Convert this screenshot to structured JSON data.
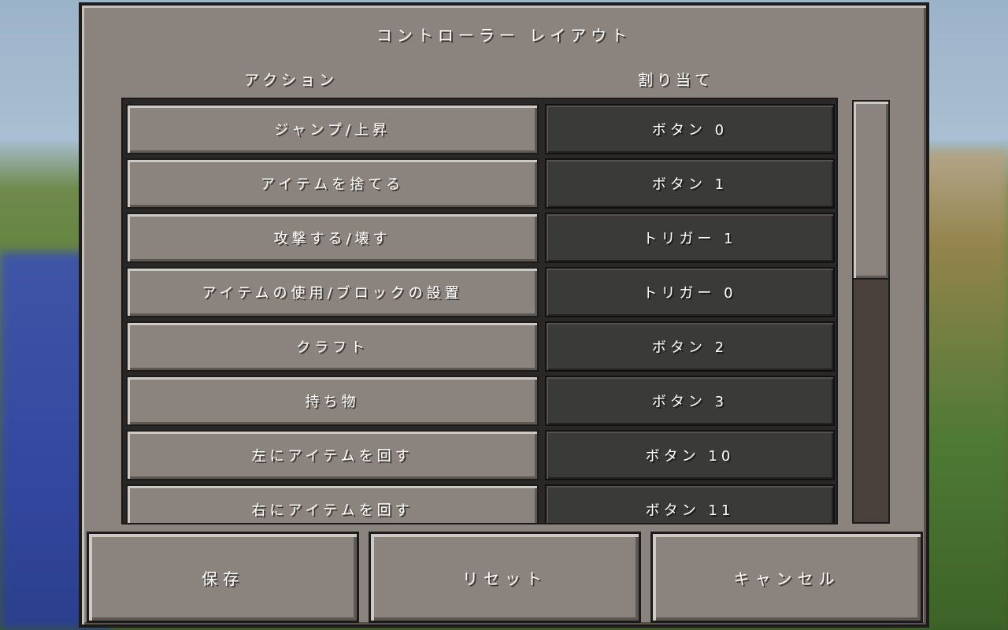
{
  "screen": {
    "title": "コントローラー レイアウト"
  },
  "columns": {
    "action": "アクション",
    "assign": "割り当て"
  },
  "rows": [
    {
      "action": "ジャンプ/上昇",
      "binding": "ボタン 0"
    },
    {
      "action": "アイテムを捨てる",
      "binding": "ボタン 1"
    },
    {
      "action": "攻撃する/壊す",
      "binding": "トリガー 1"
    },
    {
      "action": "アイテムの使用/ブロックの設置",
      "binding": "トリガー 0"
    },
    {
      "action": "クラフト",
      "binding": "ボタン 2"
    },
    {
      "action": "持ち物",
      "binding": "ボタン 3"
    },
    {
      "action": "左にアイテムを回す",
      "binding": "ボタン 10"
    },
    {
      "action": "右にアイテムを回す",
      "binding": "ボタン 11"
    }
  ],
  "buttons": {
    "save": "保存",
    "reset": "リセット",
    "cancel": "キャンセル"
  },
  "colors": {
    "panel": "#8b837d",
    "binding_bg": "#3a3a38",
    "scroll_track": "#4a403c",
    "text": "#ffffff"
  }
}
